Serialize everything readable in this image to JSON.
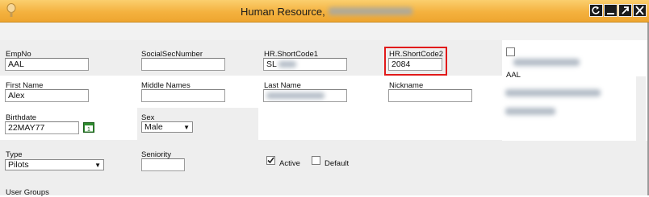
{
  "window": {
    "title": "Human Resource,",
    "buttons": [
      "help",
      "minimize",
      "popout",
      "close"
    ]
  },
  "form": {
    "empno": {
      "label": "EmpNo",
      "value": "AAL"
    },
    "social_sec": {
      "label": "SocialSecNumber",
      "value": ""
    },
    "short_code1": {
      "label": "HR.ShortCode1",
      "value": "SL"
    },
    "short_code2": {
      "label": "HR.ShortCode2",
      "value": "2084"
    },
    "first_name": {
      "label": "First Name",
      "value": "Alex"
    },
    "middle_names": {
      "label": "Middle Names",
      "value": ""
    },
    "last_name": {
      "label": "Last Name",
      "value": ""
    },
    "nickname": {
      "label": "Nickname",
      "value": ""
    },
    "birthdate": {
      "label": "Birthdate",
      "value": "22MAY77"
    },
    "sex": {
      "label": "Sex",
      "value": "Male"
    },
    "type": {
      "label": "Type",
      "value": "Pilots"
    },
    "seniority": {
      "label": "Seniority",
      "value": ""
    },
    "active": {
      "label": "Active",
      "checked": true
    },
    "default": {
      "label": "Default",
      "checked": false
    },
    "user_groups": {
      "label": "User Groups"
    }
  },
  "side": {
    "code": "AAL"
  },
  "colors": {
    "title_bar": "#f4b23f",
    "highlight_border": "#e11a1a",
    "panel_grey": "#eeeeee"
  }
}
